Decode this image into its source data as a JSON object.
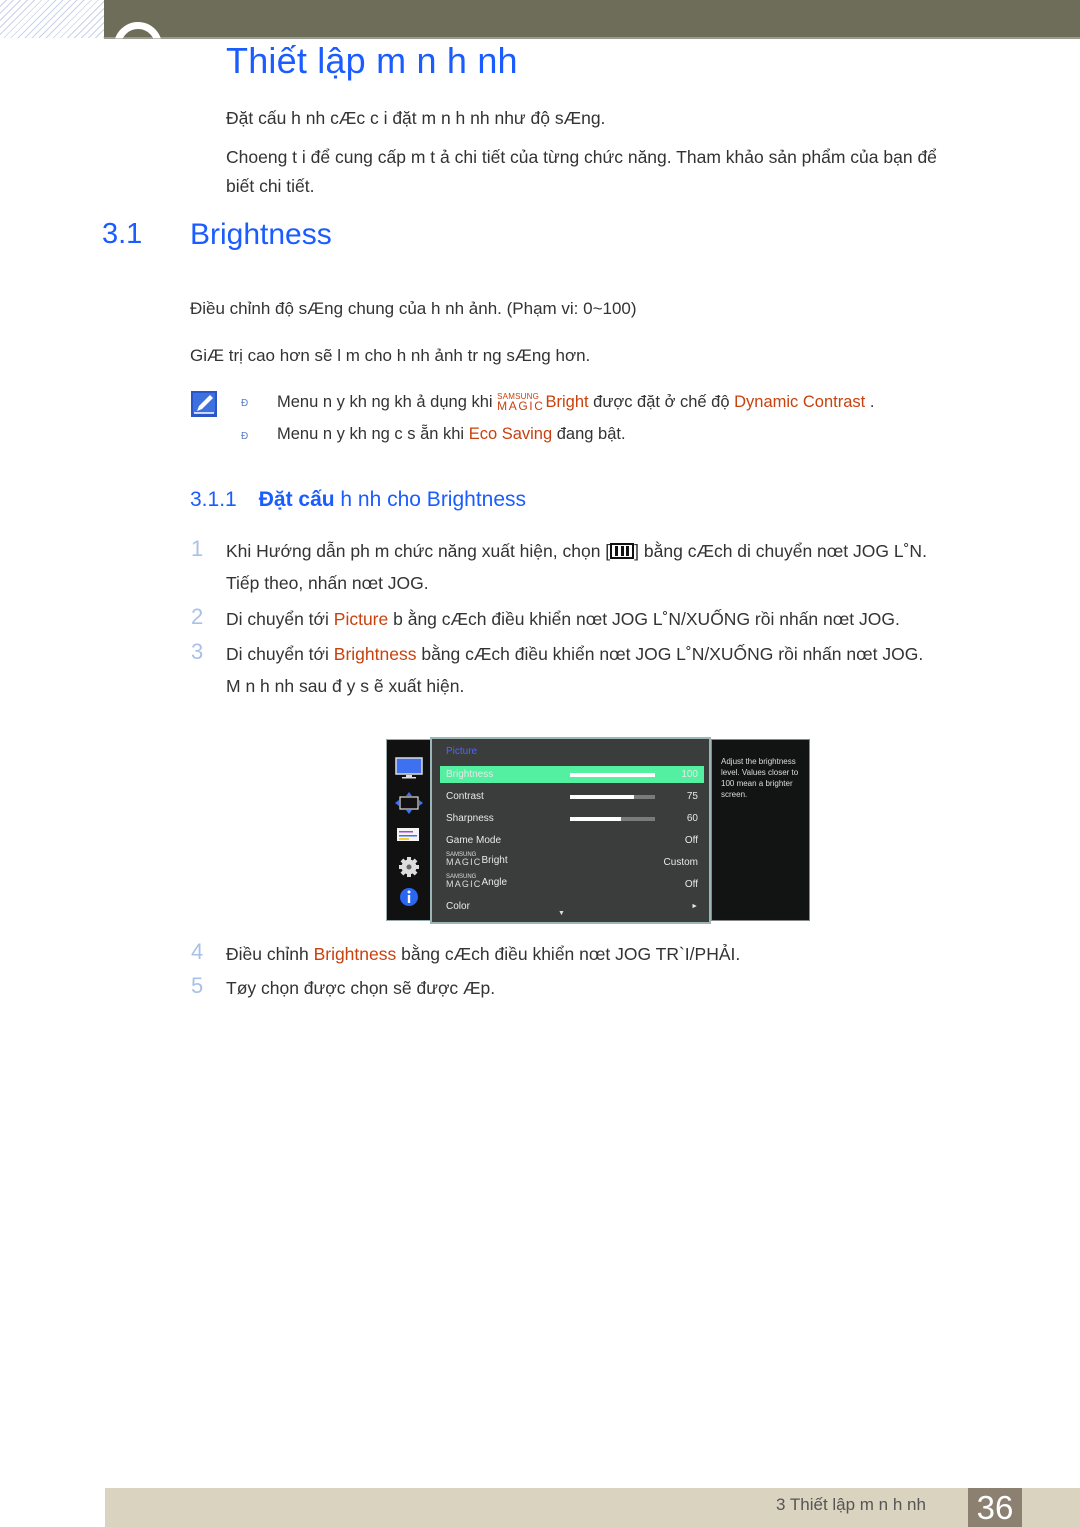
{
  "header": {
    "chapter_title": "Thiết lập m n h nh"
  },
  "intro": {
    "line1": "Đặt cấu h nh cÆc c i đặt m n h nh như  độ sÆng.",
    "line2a": "Choeng t i để cung cấp m  t ả chi tiết của từng chức năng. Tham khảo sản phẩm của bạn để",
    "line2b": "biết chi tiết."
  },
  "section": {
    "number": "3.1",
    "title": "Brightness",
    "desc1": "Điều chỉnh độ sÆng chung của h nh ảnh. (Phạm vi: 0~100)",
    "desc2": "GiÆ trị cao hơn sẽ l m cho h nh  ảnh tr ng sÆng hơn."
  },
  "notes": {
    "icon": "note-pencil-icon",
    "bullet": "Đ",
    "n1_pre": "Menu n y kh ng kh  ả dụng khi ",
    "n1_magic_small": "SAMSUNG",
    "n1_magic_big": "MAGIC",
    "n1_hl1": "Bright",
    "n1_mid": "  được đặt ở chế độ ",
    "n1_hl2": "Dynamic Contrast",
    "n1_post": "  .",
    "n2_pre": "Menu n y kh ng c  s   ẵn khi ",
    "n2_hl": "Eco Saving",
    "n2_post": "  đang bật."
  },
  "subsection": {
    "number": "3.1.1",
    "title_bold": "Đặt cấu",
    "title_rest": " h nh cho Brightness"
  },
  "steps": [
    {
      "num": "1",
      "pre": "Khi Hướng dẫn ph m chức năng xuất hiện, chọn [",
      "post": "] bằng cÆch di chuyển nœt JOG L˚N.",
      "line2": "Tiếp theo, nhấn nœt JOG."
    },
    {
      "num": "2",
      "pre": "Di chuyển tới ",
      "hl": "Picture",
      "post": " b ằng cÆch điều khiển nœt JOG L˚N/XUỐNG rồi nhấn nœt JOG."
    },
    {
      "num": "3",
      "pre": "Di chuyển tới ",
      "hl": "Brightness",
      "post": "   bằng cÆch điều khiển nœt JOG L˚N/XUỐNG rồi nhấn nœt JOG.",
      "line2": "M n h nh sau  đ y s ẽ xuất hiện."
    },
    {
      "num": "4",
      "pre": "Điều chỉnh ",
      "hl": "Brightness",
      "post": "   bằng cÆch điều khiển nœt JOG TR`I/PHẢI."
    },
    {
      "num": "5",
      "pre": "Tøy chọn được chọn sẽ được Æp."
    }
  ],
  "osd": {
    "menu_title": "Picture",
    "rows": [
      {
        "label": "Brightness",
        "value": "100",
        "bar": 1.0,
        "selected": true
      },
      {
        "label": "Contrast",
        "value": "75",
        "bar": 0.75
      },
      {
        "label": "Sharpness",
        "value": "60",
        "bar": 0.6
      },
      {
        "label": "Game Mode",
        "value": "Off"
      },
      {
        "label": "Bright",
        "magic": true,
        "value": "Custom"
      },
      {
        "label": "Angle",
        "magic": true,
        "value": "Off"
      },
      {
        "label": "Color",
        "value": "►"
      }
    ],
    "magic_small": "SAMSUNG",
    "magic_big": "MAGIC",
    "scroll_down": "▼",
    "help_text": "Adjust the brightness level. Values closer to 100 mean a brighter screen.",
    "side_icons": [
      "monitor-icon",
      "size-position-icon",
      "menu-settings-icon",
      "gear-icon",
      "info-icon"
    ]
  },
  "footer": {
    "chapter_label": "3 Thiết lập m n h nh",
    "page_number": "36"
  }
}
